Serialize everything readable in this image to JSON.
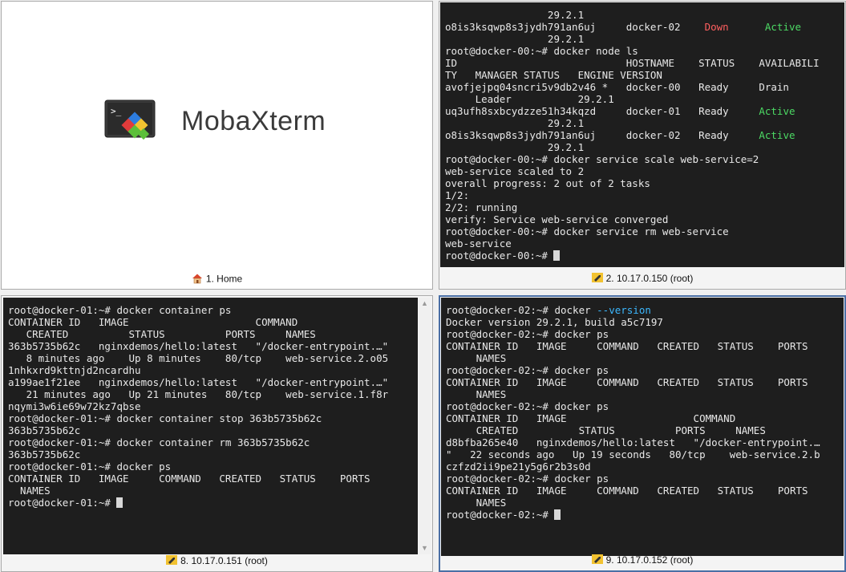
{
  "home": {
    "app_name": "MobaXterm",
    "tab_label": "1. Home",
    "home_icon": "house-icon"
  },
  "session_top": {
    "tab_label": "2. 10.17.0.150 (root)",
    "tab_icon": "wrench-icon",
    "lines": [
      [
        {
          "t": "                 29.2.1"
        }
      ],
      [
        {
          "t": "o8is3ksqwp8s3jydh791an6uj     docker-02    "
        },
        {
          "t": "Down",
          "c": "red"
        },
        {
          "t": "      "
        },
        {
          "t": "Active",
          "c": "green"
        }
      ],
      [
        {
          "t": "                 29.2.1"
        }
      ],
      [
        {
          "t": "root@docker-00:~# docker node ls"
        }
      ],
      [
        {
          "t": "ID                            HOSTNAME    STATUS    AVAILABILI"
        }
      ],
      [
        {
          "t": "TY   MANAGER STATUS   ENGINE VERSION"
        }
      ],
      [
        {
          "t": "avofjejpq04sncri5v9db2v46 *   docker-00   Ready     Drain"
        }
      ],
      [
        {
          "t": "     Leader           29.2.1"
        }
      ],
      [
        {
          "t": "uq3ufh8sxbcydzze51h34kqzd     docker-01   Ready     "
        },
        {
          "t": "Active",
          "c": "green"
        }
      ],
      [
        {
          "t": "                 29.2.1"
        }
      ],
      [
        {
          "t": "o8is3ksqwp8s3jydh791an6uj     docker-02   Ready     "
        },
        {
          "t": "Active",
          "c": "green"
        }
      ],
      [
        {
          "t": "                 29.2.1"
        }
      ],
      [
        {
          "t": "root@docker-00:~# docker service scale web-service=2"
        }
      ],
      [
        {
          "t": "web-service scaled to 2"
        }
      ],
      [
        {
          "t": "overall progress: 2 out of 2 tasks"
        }
      ],
      [
        {
          "t": "1/2:"
        }
      ],
      [
        {
          "t": "2/2: running"
        }
      ],
      [
        {
          "t": "verify: Service web-service converged"
        }
      ],
      [
        {
          "t": "root@docker-00:~# docker service rm web-service"
        }
      ],
      [
        {
          "t": "web-service"
        }
      ],
      [
        {
          "t": "root@docker-00:~# "
        },
        {
          "cursor": true
        }
      ]
    ]
  },
  "session_bottom_left": {
    "tab_label": "8. 10.17.0.151 (root)",
    "tab_icon": "wrench-icon",
    "lines": [
      [
        {
          "t": "root@docker-01:~# docker container ps"
        }
      ],
      [
        {
          "t": "CONTAINER ID   IMAGE                     COMMAND"
        }
      ],
      [
        {
          "t": "   CREATED          STATUS          PORTS     NAMES"
        }
      ],
      [
        {
          "t": "363b5735b62c   nginxdemos/hello:latest   \"/docker-entrypoint.…\""
        }
      ],
      [
        {
          "t": "   8 minutes ago    Up 8 minutes    80/tcp    web-service.2.o05"
        }
      ],
      [
        {
          "t": "1nhkxrd9kttnjd2ncardhu"
        }
      ],
      [
        {
          "t": "a199ae1f21ee   nginxdemos/hello:latest   \"/docker-entrypoint.…\""
        }
      ],
      [
        {
          "t": "   21 minutes ago   Up 21 minutes   80/tcp    web-service.1.f8r"
        }
      ],
      [
        {
          "t": "nqymi3w6ie69w72kz7qbse"
        }
      ],
      [
        {
          "t": "root@docker-01:~# docker container stop 363b5735b62c"
        }
      ],
      [
        {
          "t": "363b5735b62c"
        }
      ],
      [
        {
          "t": "root@docker-01:~# docker container rm 363b5735b62c"
        }
      ],
      [
        {
          "t": "363b5735b62c"
        }
      ],
      [
        {
          "t": "root@docker-01:~# docker ps"
        }
      ],
      [
        {
          "t": "CONTAINER ID   IMAGE     COMMAND   CREATED   STATUS    PORTS"
        }
      ],
      [
        {
          "t": "  NAMES"
        }
      ],
      [
        {
          "t": "root@docker-01:~# "
        },
        {
          "cursor": true
        }
      ]
    ]
  },
  "session_bottom_right": {
    "tab_label": "9. 10.17.0.152 (root)",
    "tab_icon": "wrench-icon",
    "lines": [
      [
        {
          "t": "root@docker-02:~# docker "
        },
        {
          "t": "--version",
          "c": "cyan"
        }
      ],
      [
        {
          "t": "Docker version 29.2.1, build a5c7197"
        }
      ],
      [
        {
          "t": "root@docker-02:~# docker ps"
        }
      ],
      [
        {
          "t": "CONTAINER ID   IMAGE     COMMAND   CREATED   STATUS    PORTS"
        }
      ],
      [
        {
          "t": "     NAMES"
        }
      ],
      [
        {
          "t": "root@docker-02:~# docker ps"
        }
      ],
      [
        {
          "t": "CONTAINER ID   IMAGE     COMMAND   CREATED   STATUS    PORTS"
        }
      ],
      [
        {
          "t": "     NAMES"
        }
      ],
      [
        {
          "t": "root@docker-02:~# docker ps"
        }
      ],
      [
        {
          "t": "CONTAINER ID   IMAGE                     COMMAND"
        }
      ],
      [
        {
          "t": "     CREATED          STATUS          PORTS     NAMES"
        }
      ],
      [
        {
          "t": "d8bfba265e40   nginxdemos/hello:latest   \"/docker-entrypoint.…"
        }
      ],
      [
        {
          "t": "\"   22 seconds ago   Up 19 seconds   80/tcp    web-service.2.b"
        }
      ],
      [
        {
          "t": "czfzd2ii9pe21y5g6r2b3s0d"
        }
      ],
      [
        {
          "t": "root@docker-02:~# docker ps"
        }
      ],
      [
        {
          "t": "CONTAINER ID   IMAGE     COMMAND   CREATED   STATUS    PORTS"
        }
      ],
      [
        {
          "t": "     NAMES"
        }
      ],
      [
        {
          "t": "root@docker-02:~# "
        },
        {
          "cursor": true
        }
      ]
    ]
  },
  "colors": {
    "terminal_bg": "#1e1e1e",
    "terminal_fg": "#e8e8e8",
    "down": "#ff5f5f",
    "active": "#4cd964",
    "flag": "#3cb8ff",
    "focus_border": "#4a6fa5"
  }
}
